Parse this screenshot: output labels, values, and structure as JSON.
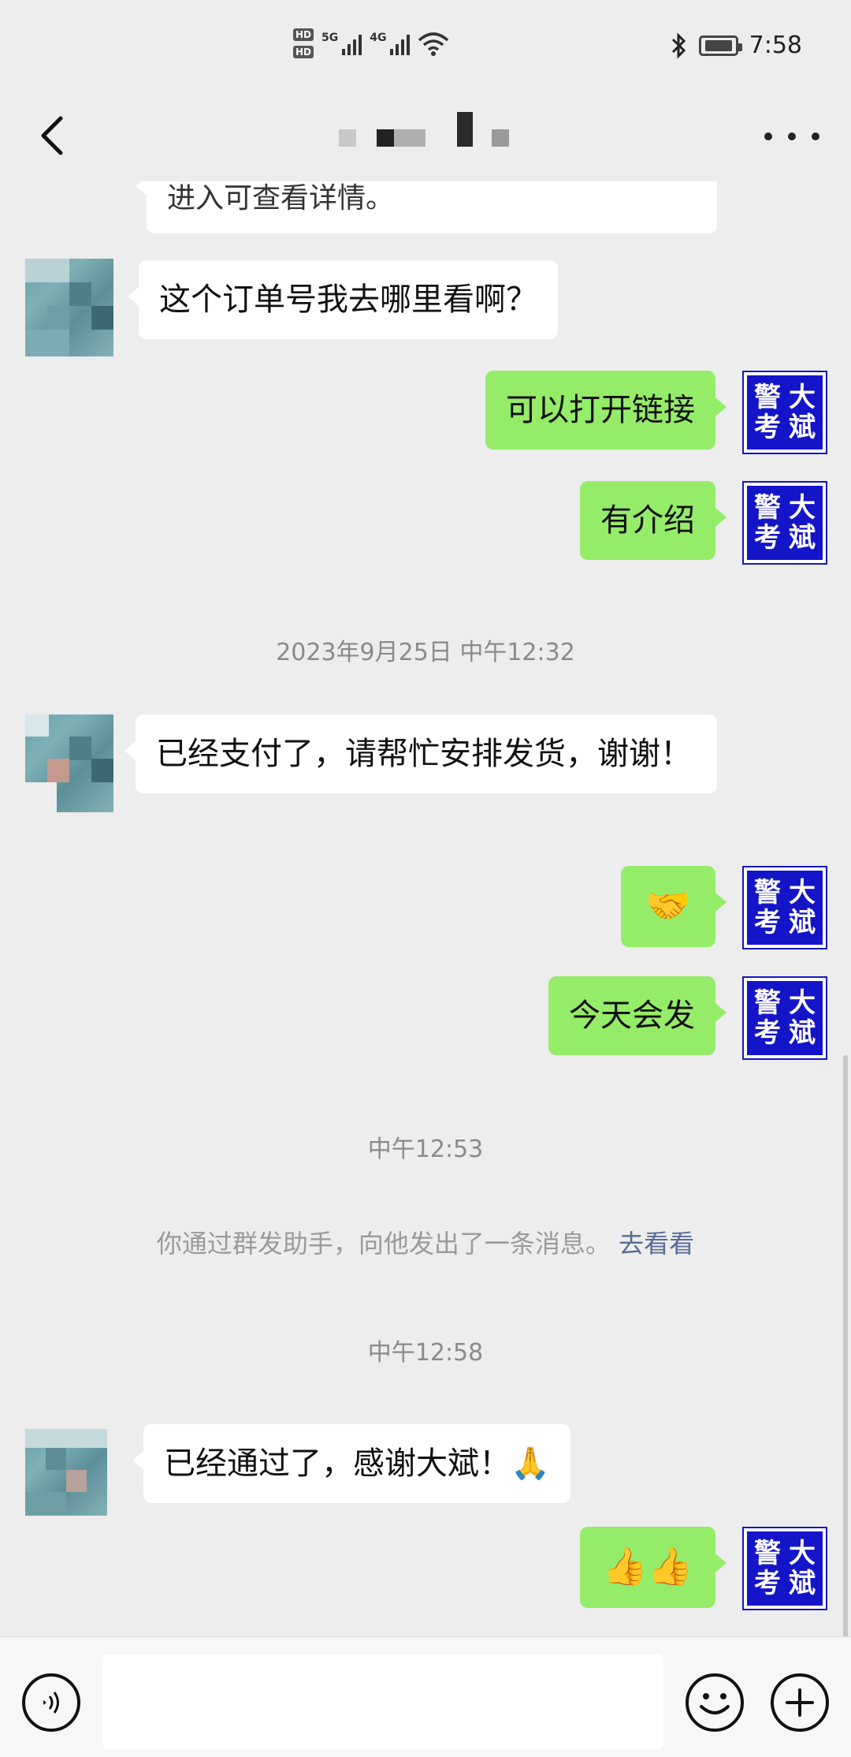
{
  "status_bar": {
    "hd1": "HD",
    "hd2": "HD",
    "net1": "5G",
    "net2": "4G",
    "time": "7:58"
  },
  "title_bar": {
    "back_icon": "chevron-left-icon",
    "more_icon": "more-dots-icon"
  },
  "messages": {
    "m0": {
      "text": "进入可查看详情。"
    },
    "m1": {
      "text": "这个订单号我去哪里看啊？"
    },
    "m2": {
      "text": "可以打开链接"
    },
    "m3": {
      "text": "有介绍"
    },
    "ts1": "2023年9月25日 中午12:32",
    "m4": {
      "text": "已经支付了，请帮忙安排发货，谢谢！"
    },
    "m5": {
      "text": "🤝"
    },
    "m6": {
      "text": "今天会发"
    },
    "ts2": "中午12:53",
    "sys1": {
      "text": "你通过群发助手，向他发出了一条消息。",
      "link": "去看看"
    },
    "ts3": "中午12:58",
    "m7": {
      "text": "已经通过了，感谢大斌！🙏"
    },
    "m8": {
      "text": "👍👍"
    }
  },
  "my_avatar": {
    "c1": "警",
    "c2": "大",
    "c3": "考",
    "c4": "斌"
  },
  "colors": {
    "background": "#ededed",
    "bubble_out": "#95ec69",
    "bubble_in": "#ffffff",
    "avatar_blue": "#1414c8",
    "link": "#576b95"
  }
}
